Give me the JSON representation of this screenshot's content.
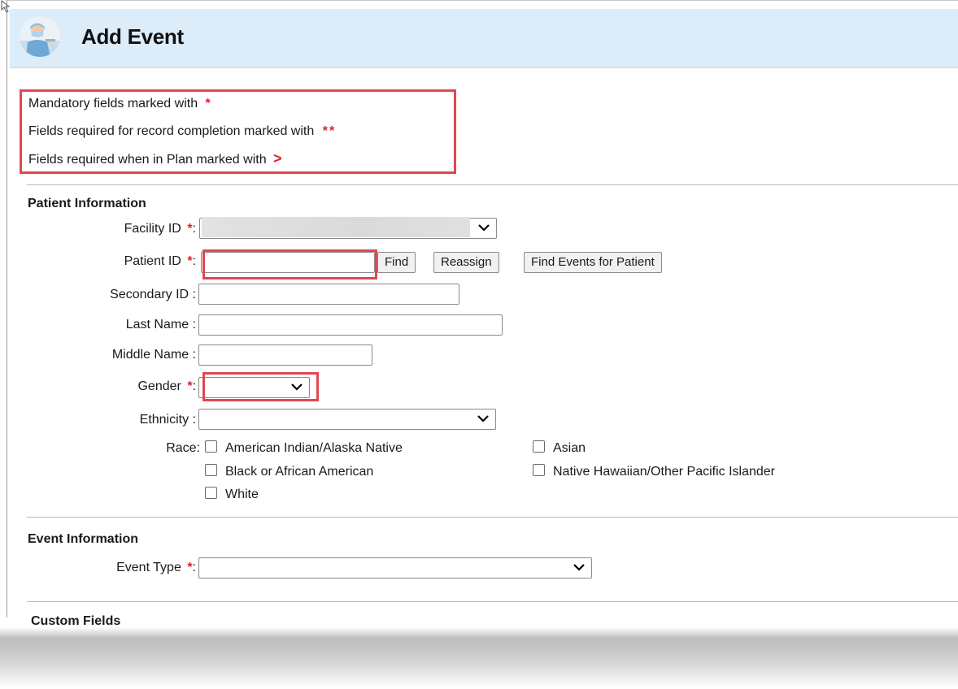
{
  "header": {
    "title": "Add Event"
  },
  "legend": {
    "mandatory_text": "Mandatory fields marked with",
    "mandatory_marker": "*",
    "completion_text": "Fields required for record completion marked with",
    "completion_marker": "**",
    "plan_text": "Fields required when in Plan marked with",
    "plan_marker": ">"
  },
  "patient": {
    "section_title": "Patient Information",
    "facility": {
      "label": "Facility ID",
      "marker": "*",
      "value": ""
    },
    "patient_id": {
      "label": "Patient ID",
      "marker": "*",
      "value": ""
    },
    "buttons": {
      "find": "Find",
      "reassign": "Reassign",
      "find_events": "Find Events for Patient"
    },
    "secondary_id": {
      "label": "Secondary ID",
      "value": ""
    },
    "last_name": {
      "label": "Last Name",
      "value": ""
    },
    "middle_name": {
      "label": "Middle Name",
      "value": ""
    },
    "gender": {
      "label": "Gender",
      "marker": "*",
      "value": ""
    },
    "ethnicity": {
      "label": "Ethnicity",
      "value": ""
    },
    "race": {
      "label": "Race:",
      "options": [
        {
          "label": "American Indian/Alaska Native",
          "checked": false
        },
        {
          "label": "Asian",
          "checked": false
        },
        {
          "label": "Black or African American",
          "checked": false
        },
        {
          "label": "Native Hawaiian/Other Pacific Islander",
          "checked": false
        },
        {
          "label": "White",
          "checked": false
        }
      ]
    }
  },
  "event": {
    "section_title": "Event Information",
    "event_type": {
      "label": "Event Type",
      "marker": "*",
      "value": ""
    }
  },
  "custom": {
    "section_title": "Custom Fields"
  },
  "colors": {
    "header_bg": "#dcecf8",
    "highlight": "#e0484f",
    "required": "#e0202a"
  }
}
